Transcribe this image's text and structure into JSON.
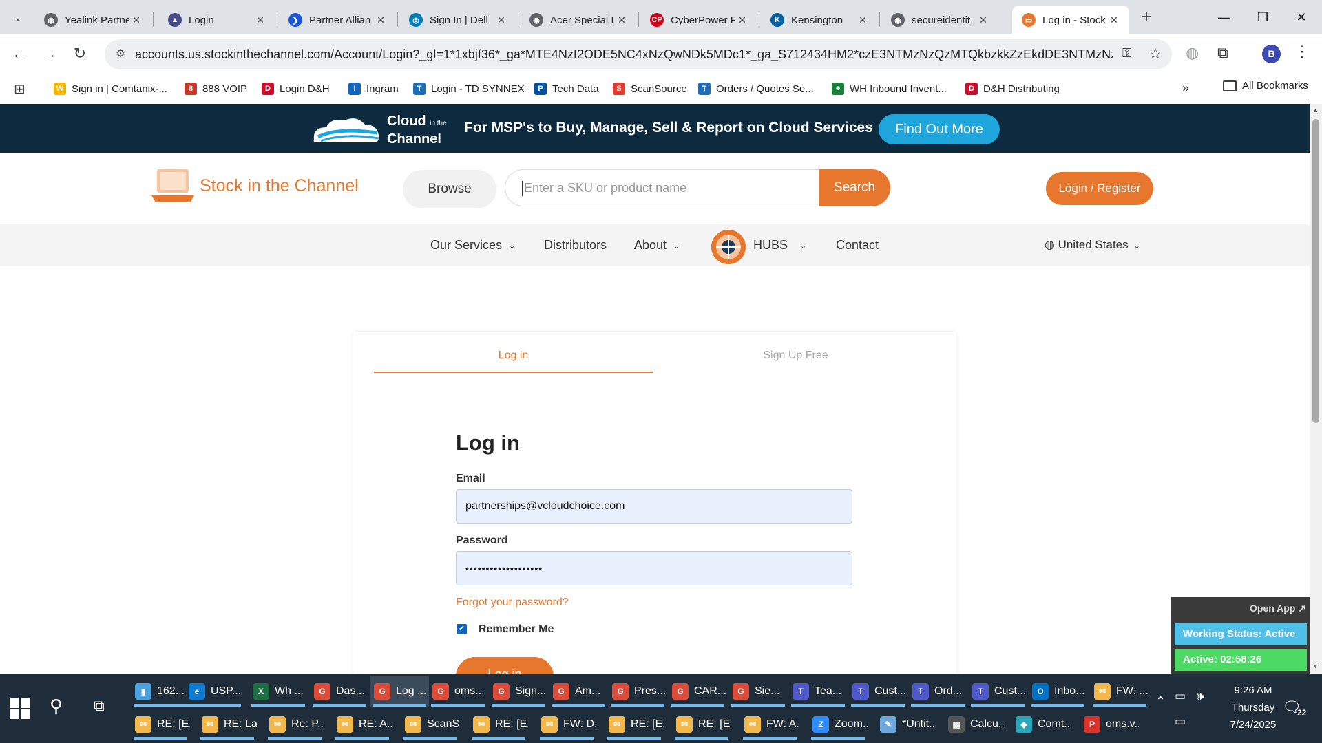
{
  "tabs": [
    {
      "label": "Yealink Partne",
      "fav_color": "#5f6368",
      "fav_glyph": "◉"
    },
    {
      "label": "Login",
      "fav_color": "#4a4a8a",
      "fav_glyph": "▲"
    },
    {
      "label": "Partner Allian",
      "fav_color": "#1a56db",
      "fav_glyph": "❯"
    },
    {
      "label": "Sign In | Dell",
      "fav_color": "#007db8",
      "fav_glyph": "◎"
    },
    {
      "label": "Acer Special I",
      "fav_color": "#5f6368",
      "fav_glyph": "◉"
    },
    {
      "label": "CyberPower F",
      "fav_color": "#d0021b",
      "fav_glyph": "CP"
    },
    {
      "label": "Kensington",
      "fav_color": "#0060a0",
      "fav_glyph": "K"
    },
    {
      "label": "secureidentit",
      "fav_color": "#5f6368",
      "fav_glyph": "◉"
    },
    {
      "label": "Log in - Stock",
      "fav_color": "#e8772e",
      "fav_glyph": "▭"
    }
  ],
  "url": "accounts.us.stockinthechannel.com/Account/Login?_gl=1*1xbjf36*_ga*MTE4NzI2ODE5NC4xNzQwNDk5MDc1*_ga_S712434HM2*czE3NTMzNzQzMTQkbzkkZzEkdDE3NTMzNzQzMz...",
  "profile_initial": "B",
  "bookmarks": [
    {
      "label": "Sign in | Comtanix-...",
      "color": "#f4b400",
      "glyph": "W"
    },
    {
      "label": "888 VOIP",
      "color": "#c0392b",
      "glyph": "8"
    },
    {
      "label": "Login D&H",
      "color": "#c8102e",
      "glyph": "D"
    },
    {
      "label": "Ingram",
      "color": "#1565c0",
      "glyph": "I"
    },
    {
      "label": "Login - TD SYNNEX",
      "color": "#1f6db5",
      "glyph": "T"
    },
    {
      "label": "Tech Data",
      "color": "#0050a0",
      "glyph": "P"
    },
    {
      "label": "ScanSource",
      "color": "#e03c31",
      "glyph": "S"
    },
    {
      "label": "Orders / Quotes Se...",
      "color": "#1f6db5",
      "glyph": "T"
    },
    {
      "label": "WH Inbound Invent...",
      "color": "#188038",
      "glyph": "+"
    },
    {
      "label": "D&H Distributing",
      "color": "#c8102e",
      "glyph": "D"
    }
  ],
  "all_bookmarks_label": "All Bookmarks",
  "promo": {
    "cloud_line1": "Cloud",
    "cloud_small": "in the",
    "cloud_line2": "Channel",
    "tagline": "For MSP's to Buy, Manage, Sell & Report on Cloud Services",
    "button": "Find Out More"
  },
  "header": {
    "logo_text": "Stock in the Channel",
    "browse": "Browse",
    "search_placeholder": "Enter a SKU or product name",
    "search_button": "Search",
    "login_register": "Login / Register"
  },
  "nav": {
    "our_services": "Our Services",
    "distributors": "Distributors",
    "about": "About",
    "hubs": "HUBS",
    "contact": "Contact",
    "region": "United States"
  },
  "login": {
    "tab_login": "Log in",
    "tab_signup": "Sign Up Free",
    "heading": "Log in",
    "email_label": "Email",
    "email_value": "partnerships@vcloudchoice.com",
    "password_label": "Password",
    "password_value": "•••••••••••••••••••",
    "forgot": "Forgot your password?",
    "remember": "Remember Me",
    "remember_checked": true,
    "submit": "Log in"
  },
  "widget": {
    "open_app": "Open App ↗",
    "working_status": "Working Status: Active",
    "active_timer": "Active: 02:58:26"
  },
  "taskbar": {
    "row1": [
      {
        "label": "162...",
        "color": "#4aa3df",
        "glyph": "▮"
      },
      {
        "label": "USP...",
        "color": "#0f7bd0",
        "glyph": "e"
      },
      {
        "label": "Wh ...",
        "color": "#1d6f42",
        "glyph": "X"
      },
      {
        "label": "Das...",
        "color": "#dd4b39",
        "glyph": "G"
      },
      {
        "label": "Log ...",
        "color": "#dd4b39",
        "glyph": "G"
      },
      {
        "label": "oms...",
        "color": "#dd4b39",
        "glyph": "G"
      },
      {
        "label": "Sign...",
        "color": "#dd4b39",
        "glyph": "G"
      },
      {
        "label": "Am...",
        "color": "#dd4b39",
        "glyph": "G"
      },
      {
        "label": "Pres...",
        "color": "#dd4b39",
        "glyph": "G"
      },
      {
        "label": "CAR...",
        "color": "#dd4b39",
        "glyph": "G"
      },
      {
        "label": "Sie...",
        "color": "#dd4b39",
        "glyph": "G"
      },
      {
        "label": "Tea...",
        "color": "#5059c9",
        "glyph": "T"
      },
      {
        "label": "Cust...",
        "color": "#5059c9",
        "glyph": "T"
      },
      {
        "label": "Ord...",
        "color": "#5059c9",
        "glyph": "T"
      },
      {
        "label": "Cust...",
        "color": "#5059c9",
        "glyph": "T"
      },
      {
        "label": "Inbo...",
        "color": "#0072c6",
        "glyph": "O"
      },
      {
        "label": "FW: ...",
        "color": "#f2b84b",
        "glyph": "✉"
      }
    ],
    "row2": [
      {
        "label": "RE: [E...",
        "color": "#f2b84b",
        "glyph": "✉"
      },
      {
        "label": "RE: La...",
        "color": "#f2b84b",
        "glyph": "✉"
      },
      {
        "label": "Re: P...",
        "color": "#f2b84b",
        "glyph": "✉"
      },
      {
        "label": "RE: A...",
        "color": "#f2b84b",
        "glyph": "✉"
      },
      {
        "label": "ScanS...",
        "color": "#f2b84b",
        "glyph": "✉"
      },
      {
        "label": "RE: [E...",
        "color": "#f2b84b",
        "glyph": "✉"
      },
      {
        "label": "FW: D...",
        "color": "#f2b84b",
        "glyph": "✉"
      },
      {
        "label": "RE: [E...",
        "color": "#f2b84b",
        "glyph": "✉"
      },
      {
        "label": "RE: [E...",
        "color": "#f2b84b",
        "glyph": "✉"
      },
      {
        "label": "FW: A...",
        "color": "#f2b84b",
        "glyph": "✉"
      },
      {
        "label": "Zoom...",
        "color": "#2d8cff",
        "glyph": "Z"
      },
      {
        "label": "*Untit...",
        "color": "#6fa8dc",
        "glyph": "✎"
      },
      {
        "label": "Calcu...",
        "color": "#555555",
        "glyph": "▦"
      },
      {
        "label": "Comt...",
        "color": "#2aa7b8",
        "glyph": "◆"
      },
      {
        "label": "oms.v...",
        "color": "#d9342b",
        "glyph": "P"
      }
    ],
    "time": "9:26 AM",
    "day": "Thursday",
    "date": "7/24/2025",
    "notif_count": "22"
  }
}
